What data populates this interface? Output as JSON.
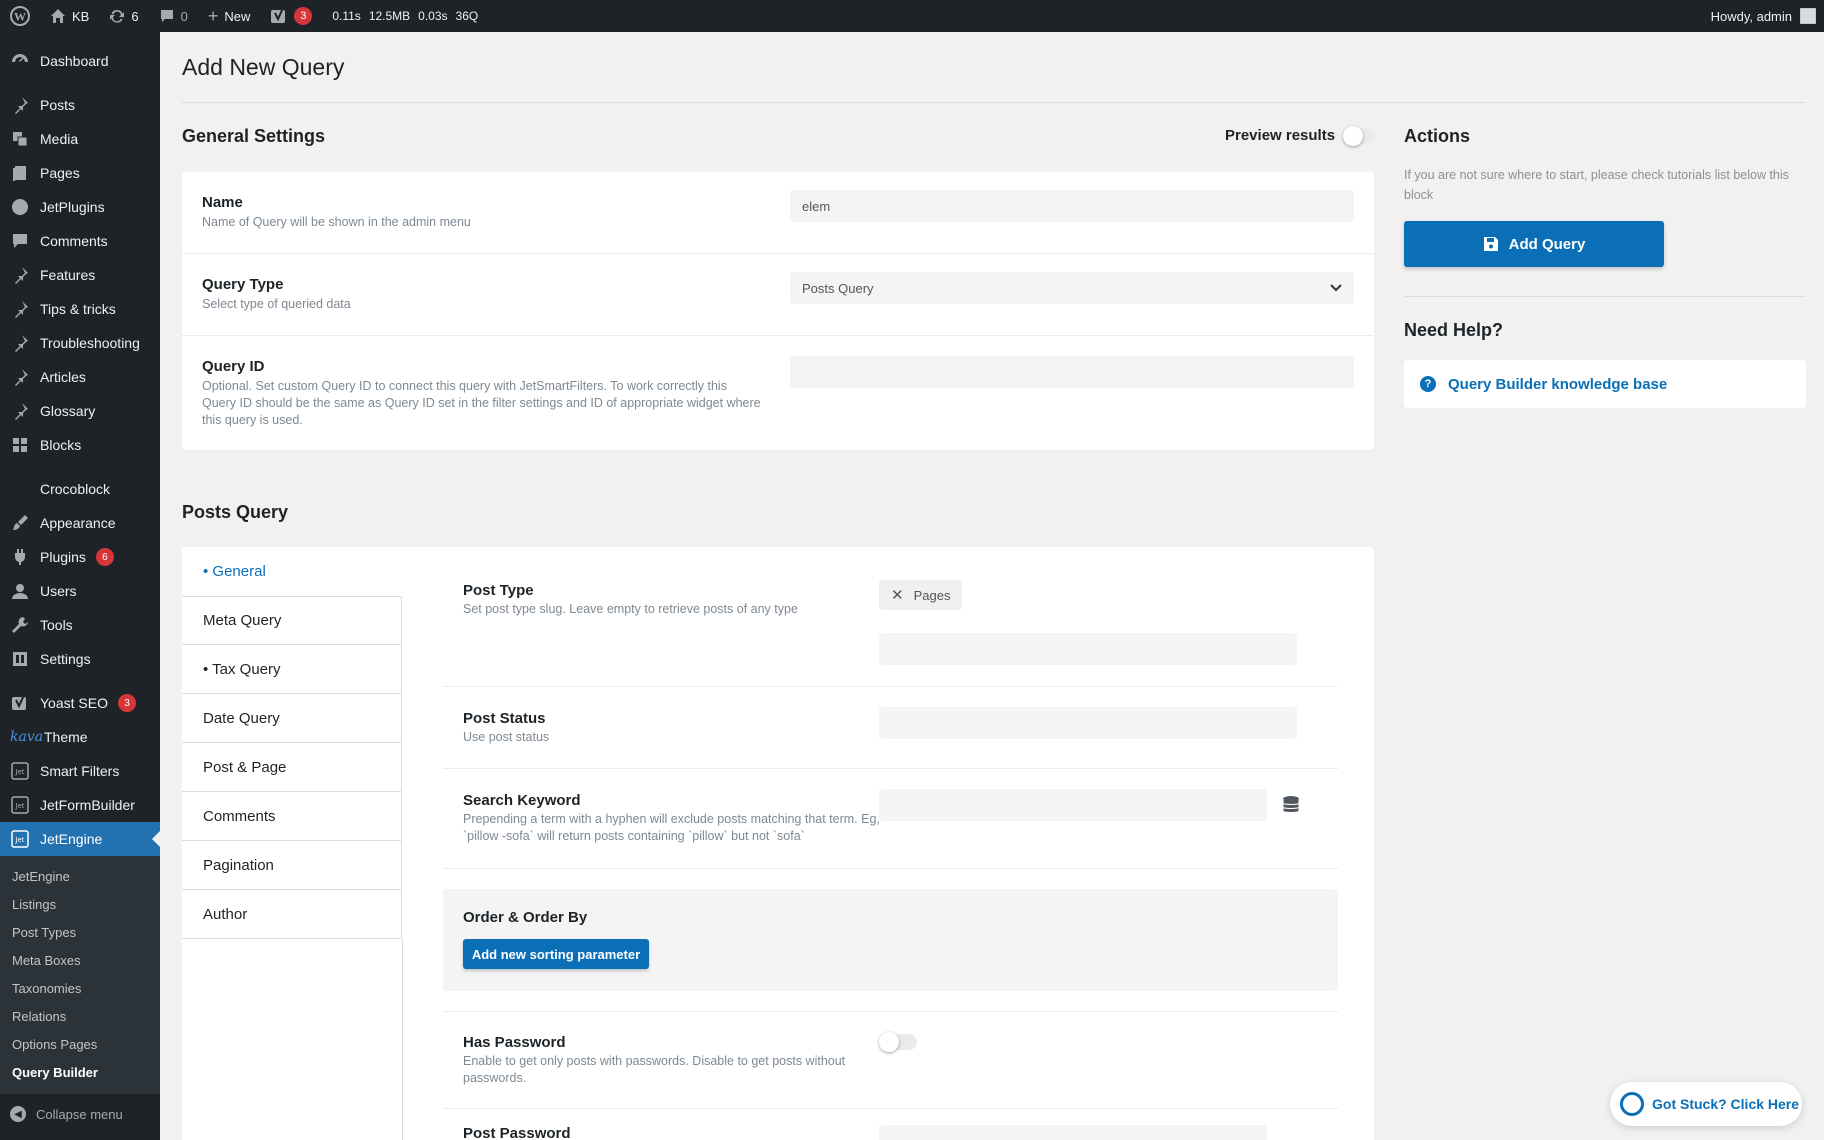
{
  "adminbar": {
    "site": "KB",
    "updates": "6",
    "comments": "0",
    "new_label": "New",
    "yoast_count": "3",
    "time": "0.11s",
    "memory": "12.5MB",
    "query_time": "0.03s",
    "queries": "36Q",
    "howdy": "Howdy, admin"
  },
  "sidebar": {
    "dashboard": "Dashboard",
    "posts": "Posts",
    "media": "Media",
    "pages": "Pages",
    "jetplugins": "JetPlugins",
    "comments": "Comments",
    "features": "Features",
    "tips": "Tips & tricks",
    "troubleshooting": "Troubleshooting",
    "articles": "Articles",
    "glossary": "Glossary",
    "blocks": "Blocks",
    "crocoblock": "Crocoblock",
    "appearance": "Appearance",
    "plugins": "Plugins",
    "plugins_badge": "6",
    "users": "Users",
    "tools": "Tools",
    "settings": "Settings",
    "yoast": "Yoast SEO",
    "yoast_badge": "3",
    "theme_brand": "kava",
    "theme": "Theme",
    "smart_filters": "Smart Filters",
    "jetformbuilder": "JetFormBuilder",
    "jetengine": "JetEngine",
    "submenu": [
      "JetEngine",
      "Listings",
      "Post Types",
      "Meta Boxes",
      "Taxonomies",
      "Relations",
      "Options Pages",
      "Query Builder"
    ],
    "collapse": "Collapse menu"
  },
  "page": {
    "title": "Add New Query",
    "general_settings": "General Settings",
    "preview_results": "Preview results",
    "name_label": "Name",
    "name_desc": "Name of Query will be shown in the admin menu",
    "name_value": "elem",
    "type_label": "Query Type",
    "type_desc": "Select type of queried data",
    "type_value": "Posts Query",
    "id_label": "Query ID",
    "id_desc": "Optional. Set custom Query ID to connect this query with JetSmartFilters. To work correctly this Query ID should be the same as Query ID set in the filter settings and ID of appropriate widget where this query is used.",
    "id_value": ""
  },
  "actions": {
    "title": "Actions",
    "hint": "If you are not sure where to start, please check tutorials list below this block",
    "add_query": "Add Query",
    "need_help": "Need Help?",
    "kb_link": "Query Builder knowledge base"
  },
  "posts_query": {
    "title": "Posts Query",
    "tabs": [
      "• General",
      "Meta Query",
      "• Tax Query",
      "Date Query",
      "Post & Page",
      "Comments",
      "Pagination",
      "Author"
    ],
    "post_type_label": "Post Type",
    "post_type_desc": "Set post type slug. Leave empty to retrieve posts of any type",
    "post_type_chip": "Pages",
    "post_status_label": "Post Status",
    "post_status_desc": "Use post status",
    "search_label": "Search Keyword",
    "search_desc": "Prepending a term with a hyphen will exclude posts matching that term. Eg, `pillow -sofa` will return posts containing `pillow` but not `sofa`",
    "order_label": "Order & Order By",
    "order_button": "Add new sorting parameter",
    "has_password_label": "Has Password",
    "has_password_desc": "Enable to get only posts with passwords. Disable to get posts without passwords.",
    "post_password_label": "Post Password"
  },
  "help_float": "Got Stuck? Click Here"
}
